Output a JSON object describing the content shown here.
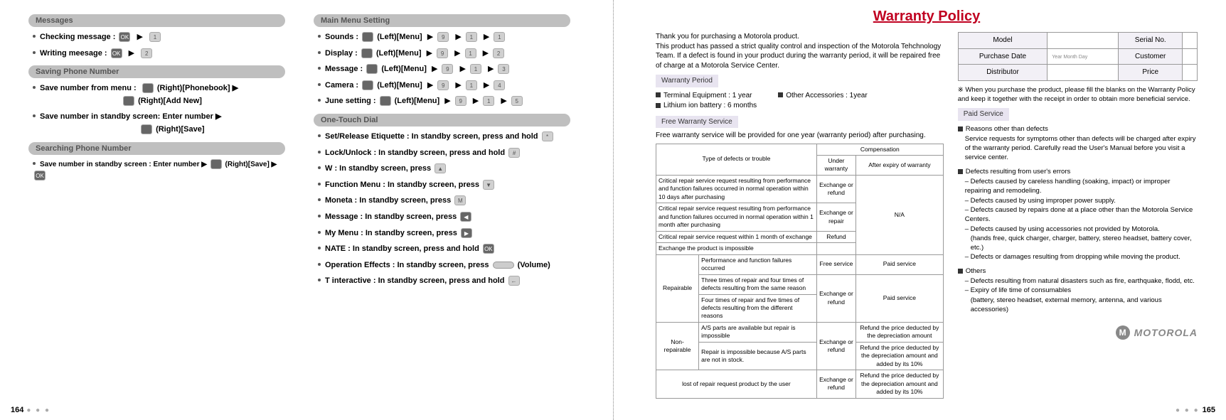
{
  "left": {
    "messages": {
      "header": "Messages",
      "items": [
        "Checking message :",
        "Writing meesage :"
      ]
    },
    "saving": {
      "header": "Saving Phone Number",
      "item1_a": "Save number from menu :",
      "item1_b": "(Right)[Phonebook]  ▶",
      "item1_c": "(Right)[Add New]",
      "item2_a": "Save number in standby screen: Enter number ▶",
      "item2_b": "(Right)[Save]"
    },
    "searching": {
      "header": "Searching Phone Number",
      "item": "Save number in standby screen : Enter number ▶",
      "tail": "(Right)[Save] ▶"
    },
    "mainmenu": {
      "header": "Main Menu Setting",
      "sounds": "Sounds :",
      "display": "Display :",
      "message": "Message :",
      "camera": "Camera :",
      "june": "June setting :",
      "leftmenu": "(Left)[Menu]"
    },
    "onetouch": {
      "header": "One-Touch Dial",
      "etiquette": "Set/Release Etiquette :  In standby screen, press and hold",
      "lock": "Lock/Unlock :  In standby screen, press and hold",
      "w": "W :  In standby screen, press",
      "func": "Function Menu :  In standby screen, press",
      "moneta": "Moneta :  In standby screen, press",
      "msg": "Message :  In standby screen, press",
      "mymenu": "My Menu :  In standby screen, press",
      "nate": "NATE :  In standby screen, press and hold",
      "op": "Operation Effects :  In standby screen, press",
      "op_tail": "(Volume)",
      "tint": "T interactive  :  In standby screen, press and hold"
    },
    "pagenum": "164"
  },
  "right": {
    "title": "Warranty Policy",
    "intro1": "Thank you for purchasing a Motorola product.",
    "intro2": "This product has passed a strict quality control and inspection of the Motorola Tehchnology Team. If a defect is found in your product during the warranty period, it will be repaired free of charge at a Motorola Service Center.",
    "wp_tag": "Warranty Period",
    "wp_l1": "Terminal Equipment : 1 year",
    "wp_l2": "Lithium ion battery : 6 months",
    "wp_r1": "Other Accessories : 1year",
    "fw_tag": "Free Warranty Service",
    "fw_line": "Free warranty service will be provided for one year (warranty period) after purchasing.",
    "tbl": {
      "h_type": "Type of defects or trouble",
      "h_comp": "Compensation",
      "h_under": "Under warranty",
      "h_after": "After expiry of warranty",
      "r1a": "Critical repair service request resulting from performance and function failures occurred in normal operation within 10 days after purchasing",
      "r1b": "Exchange or refund",
      "na": "N/A",
      "r2a": "Critical repair service request resulting from performance and function failures occurred in normal operation within 1 month after purchasing",
      "r2b": "Exchange or repair",
      "r3a": "Critical repair service request within 1 month of exchange",
      "r3b": "Refund",
      "r4a": "Exchange the product is impossible",
      "rep": "Repairable",
      "r5a": "Performance and function failures occurred",
      "r5b": "Free service",
      "r5c": "Paid service",
      "r6a": "Three times of repair and four times of defects resulting from the same reason",
      "r6b": "Exchange or refund",
      "r6c": "Paid service",
      "r7a": "Four times of repair and five times of defects resulting from the different reasons",
      "nonrep": "Non-repairable",
      "r8a": "A/S parts are available but repair is impossible",
      "r8b": "Exchange or refund",
      "r8c": "Refund the price deducted by the depreciation amount",
      "r9a": "Repair is impossible because A/S parts are not in stock.",
      "r9c": "Refund the price deducted by the depreciation amount and added by its 10%",
      "r10a": "lost of repair request product by the user",
      "r10b": "Exchange or refund",
      "r10c": "Refund the price deducted by the depreciation amount and added by its 10%"
    },
    "info": {
      "model": "Model",
      "serial": "Serial No.",
      "pdate": "Purchase Date",
      "pdate_hint": "Year   Month   Day",
      "customer": "Customer",
      "dist": "Distributor",
      "price": "Price"
    },
    "fillnote": "※ When you purchase the product, please fill the blanks on the Warranty Policy and keep it together with the receipt in order to obtain more beneficial service.",
    "paid_tag": "Paid Service",
    "p1_h": "Reasons other than defects",
    "p1_t": "Service requests for symptoms other than defects will be charged after expiry of the warranty period. Carefully read the User's Manual before you visit a service center.",
    "p2_h": "Defects resulting from user's errors",
    "p2_a": "– Defects caused by careless handling (soaking, impact) or improper repairing and remodeling.",
    "p2_b": "– Defects caused by using improper power supply.",
    "p2_c": "– Defects caused by repairs done at a place other than the Motorola Service Centers.",
    "p2_d": "– Defects caused by using accessories not provided by Motorola.",
    "p2_d2": "(hands free, quick charger, charger, battery, stereo headset, battery cover, etc.)",
    "p2_e": "– Defects or damages resulting from dropping while moving the product.",
    "p3_h": "Others",
    "p3_a": "– Defects resulting from natural disasters such as fire, earthquake, flodd, etc.",
    "p3_b": "– Expiry of life time of consumables",
    "p3_b2": "(battery, stereo headset, external memory, antenna, and various accessories)",
    "logo_text": "MOTOROLA",
    "pagenum": "165"
  }
}
